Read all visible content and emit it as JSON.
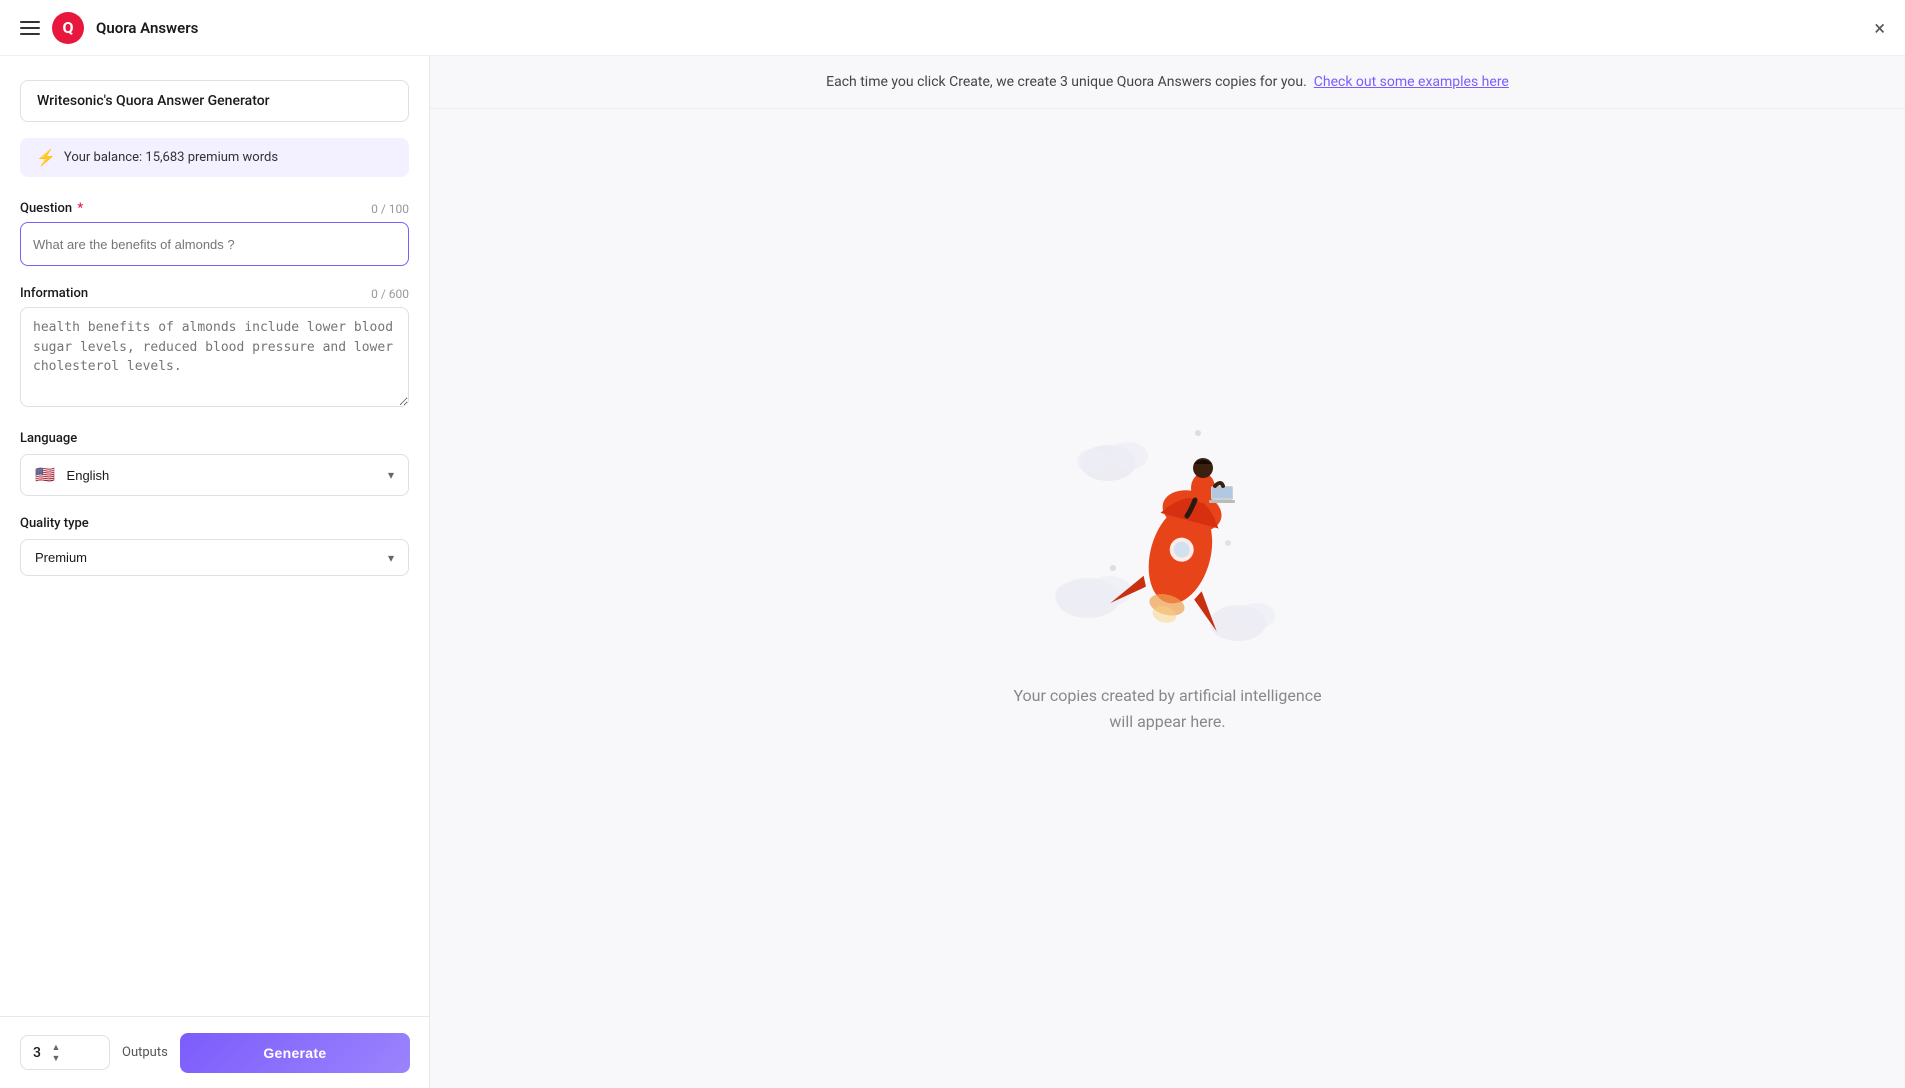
{
  "topbar": {
    "app_title": "Quora Answers",
    "logo_letter": "Q",
    "close_label": "×"
  },
  "left_panel": {
    "tool_title": "Writesonic's Quora Answer Generator",
    "balance_label": "Your balance: 15,683 premium words",
    "question_field": {
      "label": "Question",
      "required": true,
      "counter": "0 / 100",
      "placeholder": "What are the benefits of almonds ?"
    },
    "information_field": {
      "label": "Information",
      "counter": "0 / 600",
      "placeholder": "health benefits of almonds include lower blood sugar levels, reduced blood pressure and lower cholesterol levels."
    },
    "language_field": {
      "label": "Language",
      "selected": "English",
      "flag": "🇺🇸"
    },
    "quality_field": {
      "label": "Quality type",
      "selected": "Premium"
    }
  },
  "bottom_bar": {
    "outputs_value": "3",
    "outputs_label": "Outputs",
    "generate_label": "Generate"
  },
  "right_panel": {
    "notice_text": "Each time you click Create, we create 3 unique Quora Answers copies for you.",
    "notice_link": "Check out some examples here",
    "placeholder_line1": "Your copies created by artificial intelligence",
    "placeholder_line2": "will appear here."
  }
}
